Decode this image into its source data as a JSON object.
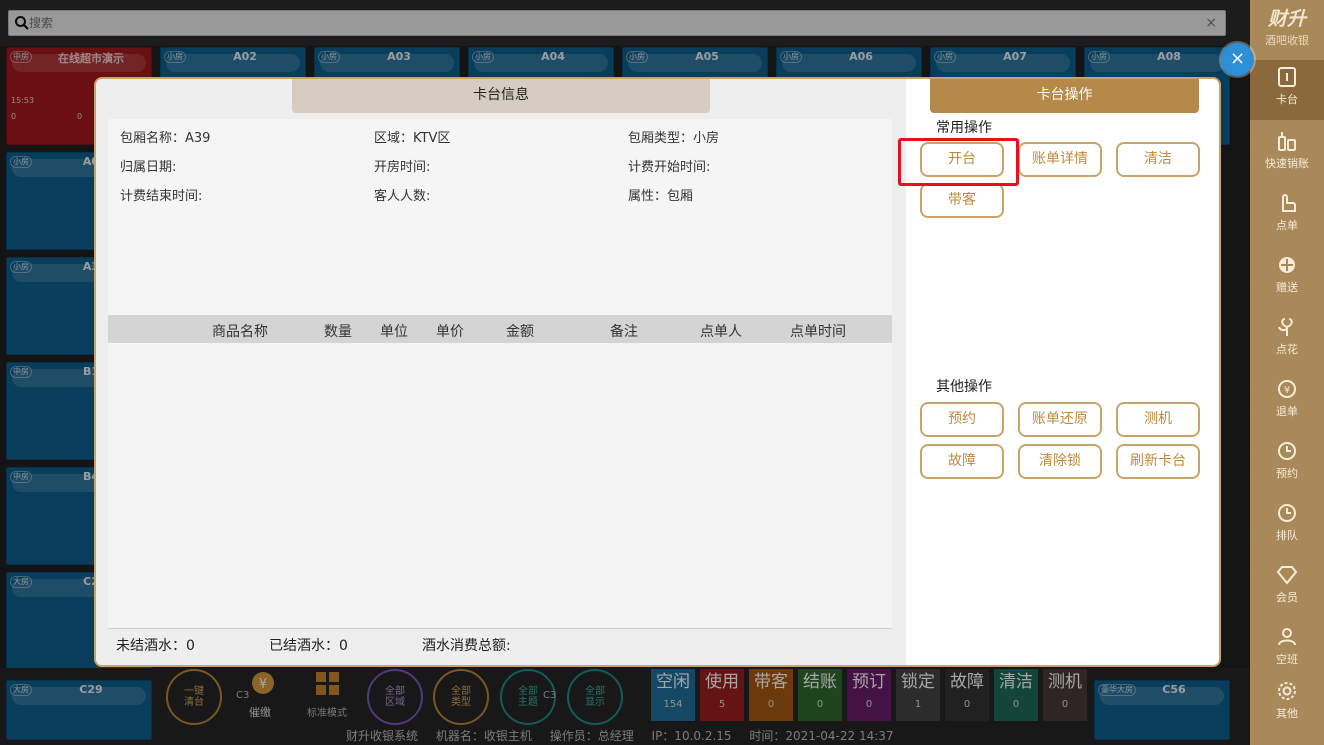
{
  "search": {
    "placeholder": "搜索",
    "clear": "×"
  },
  "sidebar": {
    "brand_title": "财升",
    "brand_sub": "酒吧收银",
    "items": [
      {
        "label": "卡台",
        "icon": "table-icon"
      },
      {
        "label": "快速销账",
        "icon": "bottles-icon"
      },
      {
        "label": "点单",
        "icon": "hand-icon"
      },
      {
        "label": "赠送",
        "icon": "gift-icon"
      },
      {
        "label": "点花",
        "icon": "flower-icon"
      },
      {
        "label": "退单",
        "icon": "refund-icon"
      },
      {
        "label": "预约",
        "icon": "clock-icon"
      },
      {
        "label": "排队",
        "icon": "clock-icon"
      },
      {
        "label": "会员",
        "icon": "diamond-icon"
      },
      {
        "label": "空班",
        "icon": "person-icon"
      },
      {
        "label": "其他",
        "icon": "gear-icon"
      }
    ]
  },
  "tiles": {
    "row1": [
      {
        "tag": "中房",
        "name": "在线超市演示",
        "time": "15:53",
        "v1": "0",
        "v2": "0"
      },
      {
        "tag": "小房",
        "name": "A02"
      },
      {
        "tag": "小房",
        "name": "A03"
      },
      {
        "tag": "小房",
        "name": "A04"
      },
      {
        "tag": "小房",
        "name": "A05"
      },
      {
        "tag": "小房",
        "name": "A06"
      },
      {
        "tag": "小房",
        "name": "A07"
      },
      {
        "tag": "小房",
        "name": "A08"
      }
    ],
    "left_col": [
      {
        "tag": "小房",
        "name": "A0"
      },
      {
        "tag": "小房",
        "name": "A3"
      },
      {
        "tag": "中房",
        "name": "B1"
      },
      {
        "tag": "中房",
        "name": "B4"
      },
      {
        "tag": "大房",
        "name": "C2"
      }
    ],
    "bottom": [
      {
        "tag": "大房",
        "name": "C29"
      },
      {
        "tag": "豪华大房",
        "name": "C56"
      }
    ]
  },
  "modal": {
    "info_tab": "卡台信息",
    "ops_tab": "卡台操作",
    "info": {
      "room_name": "包厢名称：A39",
      "area": "区域：KTV区",
      "room_type": "包厢类型：小房",
      "date": "归属日期:",
      "open_time": "开房时间:",
      "bill_start": "计费开始时间:",
      "bill_end": "计费结束时间:",
      "guests": "客人人数:",
      "attr": "属性：包厢"
    },
    "columns": [
      "商品名称",
      "数量",
      "单位",
      "单价",
      "金额",
      "备注",
      "点单人",
      "点单时间"
    ],
    "summary": {
      "unsettled": "未结酒水：0",
      "settled": "已结酒水：0",
      "total": "酒水消费总额:"
    },
    "common_title": "常用操作",
    "common_ops": [
      "开台",
      "账单详情",
      "清洁",
      "带客"
    ],
    "other_title": "其他操作",
    "other_ops": [
      "预约",
      "账单还原",
      "测机",
      "故障",
      "清除锁",
      "刷新卡台"
    ]
  },
  "bottom_bar": {
    "circles": [
      "一键\n清台",
      "全部\n区域",
      "全部\n类型",
      "全部\n主题",
      "全部\n显示"
    ],
    "hidden_labels": {
      "c3x": "C3",
      "cxx": "C3",
      "pay": "催缴",
      "mode": "标准模式"
    },
    "stats": [
      {
        "label": "空闲",
        "count": "154",
        "color": "#1f6f9a"
      },
      {
        "label": "使用",
        "count": "5",
        "color": "#9a1f1f"
      },
      {
        "label": "带客",
        "count": "0",
        "color": "#a85a14"
      },
      {
        "label": "结账",
        "count": "0",
        "color": "#2f6b2f"
      },
      {
        "label": "预订",
        "count": "0",
        "color": "#6a1c6a"
      },
      {
        "label": "锁定",
        "count": "1",
        "color": "#444444"
      },
      {
        "label": "故障",
        "count": "0",
        "color": "#333333"
      },
      {
        "label": "清洁",
        "count": "0",
        "color": "#1f6a5a"
      },
      {
        "label": "测机",
        "count": "0",
        "color": "#4a3a3a"
      }
    ],
    "footer": {
      "system": "财升收银系统",
      "machine": "机器名：收银主机",
      "operator": "操作员：总经理",
      "ip": "IP：10.0.2.15",
      "time": "时间：2021-04-22 14:37"
    }
  },
  "colors": {
    "accent": "#b5894a",
    "highlight": "#e8101e",
    "close": "#2d8fd6"
  }
}
